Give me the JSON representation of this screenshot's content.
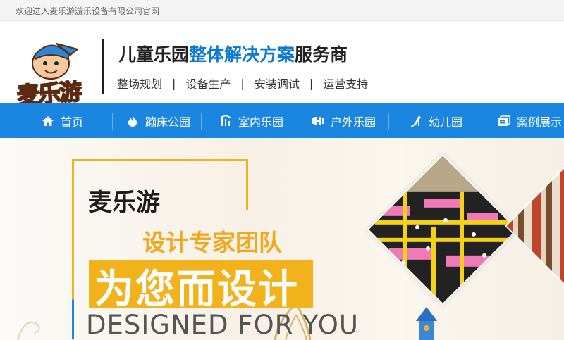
{
  "topbar": {
    "welcome": "欢迎进入麦乐游游乐设备有限公司官网"
  },
  "logo": {
    "text": "麦乐游"
  },
  "header": {
    "slogan_prefix": "儿童乐园",
    "slogan_highlight": "整体解决方案",
    "slogan_suffix": "服务商",
    "services": [
      "整场规划",
      "设备生产",
      "安装调试",
      "运营支持"
    ],
    "separator": "|"
  },
  "nav": {
    "items": [
      {
        "label": "首页",
        "icon": "home-icon"
      },
      {
        "label": "蹦床公园",
        "icon": "flame-icon"
      },
      {
        "label": "室内乐园",
        "icon": "indoor-icon"
      },
      {
        "label": "户外乐园",
        "icon": "dumbbell-icon"
      },
      {
        "label": "幼儿园",
        "icon": "slide-icon"
      },
      {
        "label": "案例展示",
        "icon": "cases-icon"
      }
    ]
  },
  "banner": {
    "brand": "麦乐游",
    "team": "设计专家团队",
    "for_you": "为您而设计",
    "designed": "DESIGNED FOR YOU"
  },
  "colors": {
    "primary": "#1b86e0",
    "accent": "#f2b21c",
    "highlight": "#0a7ad6"
  }
}
